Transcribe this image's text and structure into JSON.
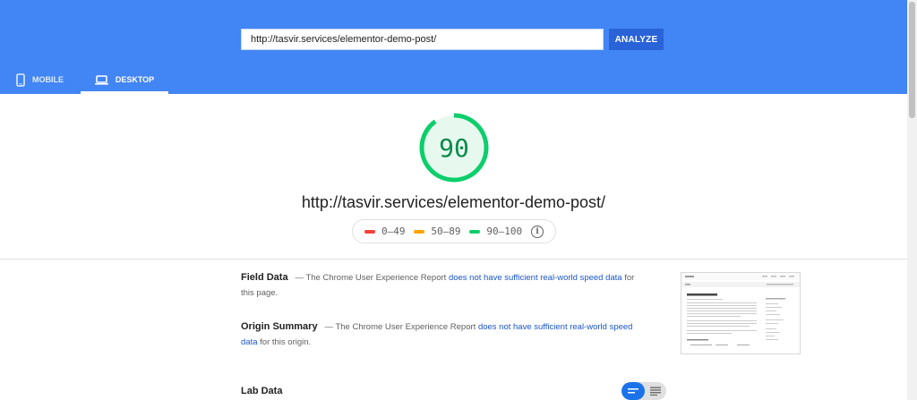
{
  "header": {
    "url_value": "http://tasvir.services/elementor-demo-post/",
    "analyze_label": "ANALYZE",
    "tabs": [
      {
        "label": "MOBILE",
        "icon": "phone-icon",
        "selected": false
      },
      {
        "label": "DESKTOP",
        "icon": "laptop-icon",
        "selected": true
      }
    ]
  },
  "summary": {
    "score": "90",
    "score_fraction": 0.9,
    "page_url": "http://tasvir.services/elementor-demo-post/",
    "legend": [
      {
        "label": "0–49",
        "color": "#f44336"
      },
      {
        "label": "50–89",
        "color": "#ffa400"
      },
      {
        "label": "90–100",
        "color": "#0cce6b"
      }
    ]
  },
  "field_data": {
    "title": "Field Data",
    "dash": "—",
    "text_before": "The Chrome User Experience Report",
    "link": "does not have sufficient real-world speed data",
    "text_after": "for this page."
  },
  "origin_summary": {
    "title": "Origin Summary",
    "dash": "—",
    "text_before": "The Chrome User Experience Report",
    "link": "does not have sufficient real-world speed data",
    "text_after": "for this origin."
  },
  "lab_data": {
    "title": "Lab Data"
  },
  "colors": {
    "header_bg": "#4285f4",
    "analyze_bg": "#2a63d8",
    "score_good": "#0cce6b",
    "link": "#1a56c8"
  }
}
